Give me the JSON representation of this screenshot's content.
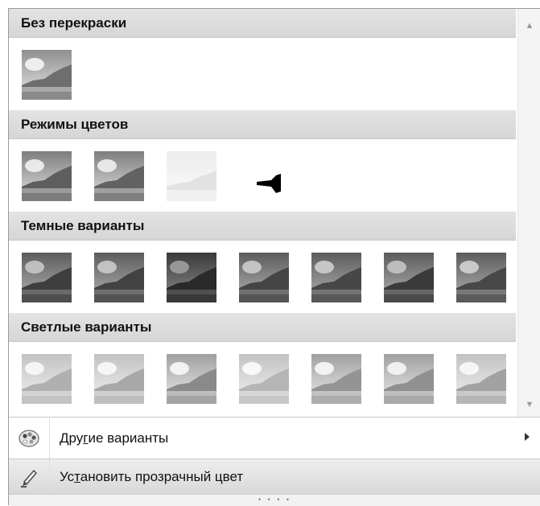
{
  "sections": [
    {
      "title": "Без перекраски",
      "thumbs": [
        "normal"
      ]
    },
    {
      "title": "Режимы цветов",
      "thumbs": [
        "grayscale",
        "grayscale",
        "washout",
        "black-white"
      ]
    },
    {
      "title": "Темные варианты",
      "thumbs": [
        "dark",
        "dark",
        "dark",
        "dark",
        "dark",
        "dark",
        "dark"
      ]
    },
    {
      "title": "Светлые варианты",
      "thumbs": [
        "light",
        "light",
        "light",
        "light",
        "light",
        "light",
        "light"
      ]
    }
  ],
  "menu": {
    "more_variants": {
      "before": "Дру",
      "underlined": "г",
      "after": "ие варианты",
      "icon": "palette-icon"
    },
    "set_transparent": {
      "before": "Ус",
      "underlined": "т",
      "after": "ановить прозрачный цвет",
      "icon": "pen-icon"
    }
  },
  "scrollbar": {
    "up_icon": "scroll-up-arrow-icon",
    "down_icon": "scroll-down-arrow-icon"
  },
  "grip": {
    "icon": "resize-grip-icon"
  }
}
